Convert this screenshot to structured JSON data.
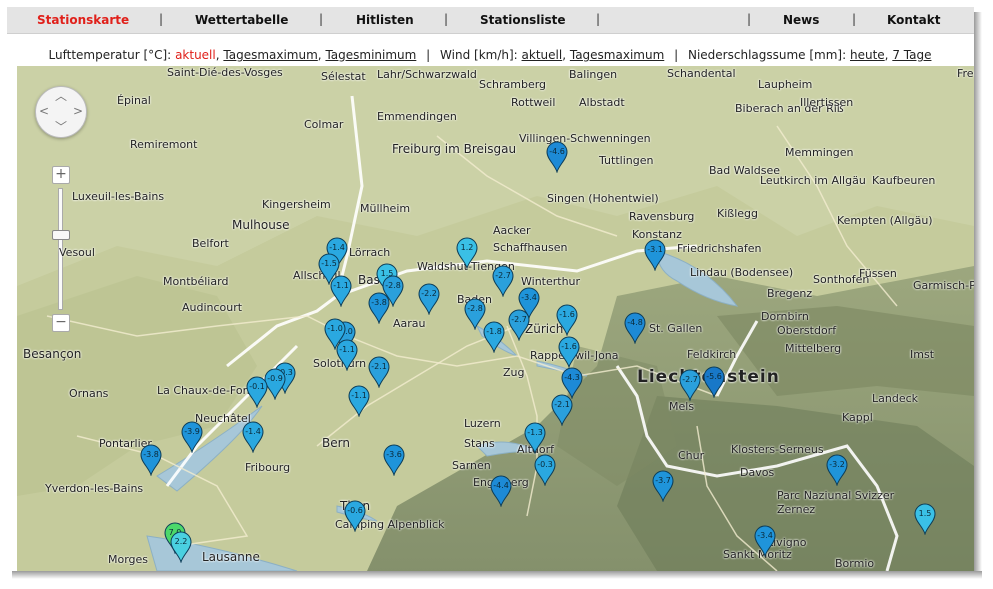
{
  "nav": {
    "items": [
      "Stationskarte",
      "Wettertabelle",
      "Hitlisten",
      "Stationsliste",
      "News",
      "Kontakt"
    ],
    "active": "Stationskarte"
  },
  "legend": {
    "temp_label": "Lufttemperatur [°C]:",
    "temp_links": [
      "aktuell",
      "Tagesmaximum",
      "Tagesminimum"
    ],
    "wind_label": "Wind [km/h]:",
    "wind_links": [
      "aktuell",
      "Tagesmaximum"
    ],
    "rain_label": "Niederschlagssume [mm]:",
    "rain_links": [
      "heute",
      "7 Tage"
    ],
    "active_link": "aktuell"
  },
  "map": {
    "zoom_in": "+",
    "zoom_out": "−",
    "places": [
      "Saint-Dié-des-Vosges",
      "Sélestat",
      "Lahr/Schwarzwald",
      "Schramberg",
      "Balingen",
      "Schandental",
      "Freude",
      "Épinal",
      "Colmar",
      "Emmendingen",
      "Rottweil",
      "Albstadt",
      "Laupheim",
      "Biberach an der Riß",
      "Illertissen",
      "Remiremont",
      "Freiburg im Breisgau",
      "Villingen-Schwenningen",
      "Tuttlingen",
      "Memmingen",
      "Luxeuil-les-Bains",
      "Kingersheim",
      "Müllheim",
      "Singen (Hohentwiel)",
      "Bad Waldsee",
      "Leutkirch im Allgäu",
      "Kaufbeuren",
      "Mulhouse",
      "Ravensburg",
      "Kißlegg",
      "Kempten (Allgäu)",
      "Vesoul",
      "Belfort",
      "Lörrach",
      "Aacker",
      "Schaffhausen",
      "Konstanz",
      "Friedrichshafen",
      "Montbéliard",
      "Allschwil",
      "Basel",
      "Waldshut-Tiengen",
      "Winterthur",
      "Lindau (Bodensee)",
      "Sonthofen",
      "Füssen",
      "Audincourt",
      "Baden",
      "Bregenz",
      "Garmisch-P",
      "Aarau",
      "Dornbirn",
      "Oberstdorf",
      "Zürich",
      "St. Gallen",
      "Besançon",
      "Solothurn",
      "Rapperswil-Jona",
      "Feldkirch",
      "Mittelberg",
      "Imst",
      "Zug",
      "Liechtenstein",
      "Ornans",
      "La Chaux-de-Fonds",
      "Neuchâtel",
      "Mels",
      "Landeck",
      "Luzern",
      "Kappl",
      "Pontarlier",
      "Bern",
      "Stans",
      "Altdorf",
      "Chur",
      "Klosters-Serneus",
      "Fribourg",
      "Sarnen",
      "Davos",
      "Engelberg",
      "Yverdon-les-Bains",
      "Thun",
      "Parc Naziunal Svizzer",
      "Camping Alpenblick",
      "Zernez",
      "Sankt Moritz",
      "Livigno",
      "Morges",
      "Lausanne",
      "Bormio"
    ],
    "markers": [
      {
        "value": "-4.6",
        "color": "#1d8ad6"
      },
      {
        "value": "-1.4",
        "color": "#2aa8e0"
      },
      {
        "value": "-1.5",
        "color": "#2aa8e0"
      },
      {
        "value": "1.2",
        "color": "#3ac0e6"
      },
      {
        "value": "-3.1",
        "color": "#1f94da"
      },
      {
        "value": "1.5",
        "color": "#3ac0e6"
      },
      {
        "value": "-2.8",
        "color": "#2aa0dc"
      },
      {
        "value": "-1.1",
        "color": "#2aa8e0"
      },
      {
        "value": "-2.7",
        "color": "#2aa0dc"
      },
      {
        "value": "-2.2",
        "color": "#2aa0dc"
      },
      {
        "value": "-3.8",
        "color": "#1f94da"
      },
      {
        "value": "-3.4",
        "color": "#1f94da"
      },
      {
        "value": "-2.8",
        "color": "#2aa0dc"
      },
      {
        "value": "-2.7",
        "color": "#2aa0dc"
      },
      {
        "value": "-1.8",
        "color": "#2aa8e0"
      },
      {
        "value": "-4.8",
        "color": "#1d8ad6"
      },
      {
        "value": "-1.6",
        "color": "#2aa8e0"
      },
      {
        "value": "-2.0",
        "color": "#2aa0dc"
      },
      {
        "value": "-1.0",
        "color": "#2aa8e0"
      },
      {
        "value": "-1.1",
        "color": "#2aa8e0"
      },
      {
        "value": "-1.6",
        "color": "#2aa8e0"
      },
      {
        "value": "-4.3",
        "color": "#1d8ad6"
      },
      {
        "value": "-2.7",
        "color": "#2aa0dc"
      },
      {
        "value": "-5.6",
        "color": "#1878c8"
      },
      {
        "value": "-0.3",
        "color": "#2aa8e0"
      },
      {
        "value": "-0.9",
        "color": "#2aa8e0"
      },
      {
        "value": "-0.1",
        "color": "#2aa8e0"
      },
      {
        "value": "-2.1",
        "color": "#2aa0dc"
      },
      {
        "value": "-1.1",
        "color": "#2aa8e0"
      },
      {
        "value": "-2.1",
        "color": "#2aa0dc"
      },
      {
        "value": "-3.9",
        "color": "#1f94da"
      },
      {
        "value": "-1.4",
        "color": "#2aa8e0"
      },
      {
        "value": "-1.3",
        "color": "#2aa8e0"
      },
      {
        "value": "-3.8",
        "color": "#1f94da"
      },
      {
        "value": "-3.6",
        "color": "#1f94da"
      },
      {
        "value": "-0.3",
        "color": "#2aa8e0"
      },
      {
        "value": "-3.7",
        "color": "#1f94da"
      },
      {
        "value": "-3.2",
        "color": "#1f94da"
      },
      {
        "value": "-4.4",
        "color": "#1d8ad6"
      },
      {
        "value": "-0.6",
        "color": "#2aa8e0"
      },
      {
        "value": "1.5",
        "color": "#3ac0e6"
      },
      {
        "value": "-3.4",
        "color": "#1f94da"
      },
      {
        "value": "7.0",
        "color": "#4cd86a"
      },
      {
        "value": "2.2",
        "color": "#4ad0e0"
      }
    ]
  }
}
